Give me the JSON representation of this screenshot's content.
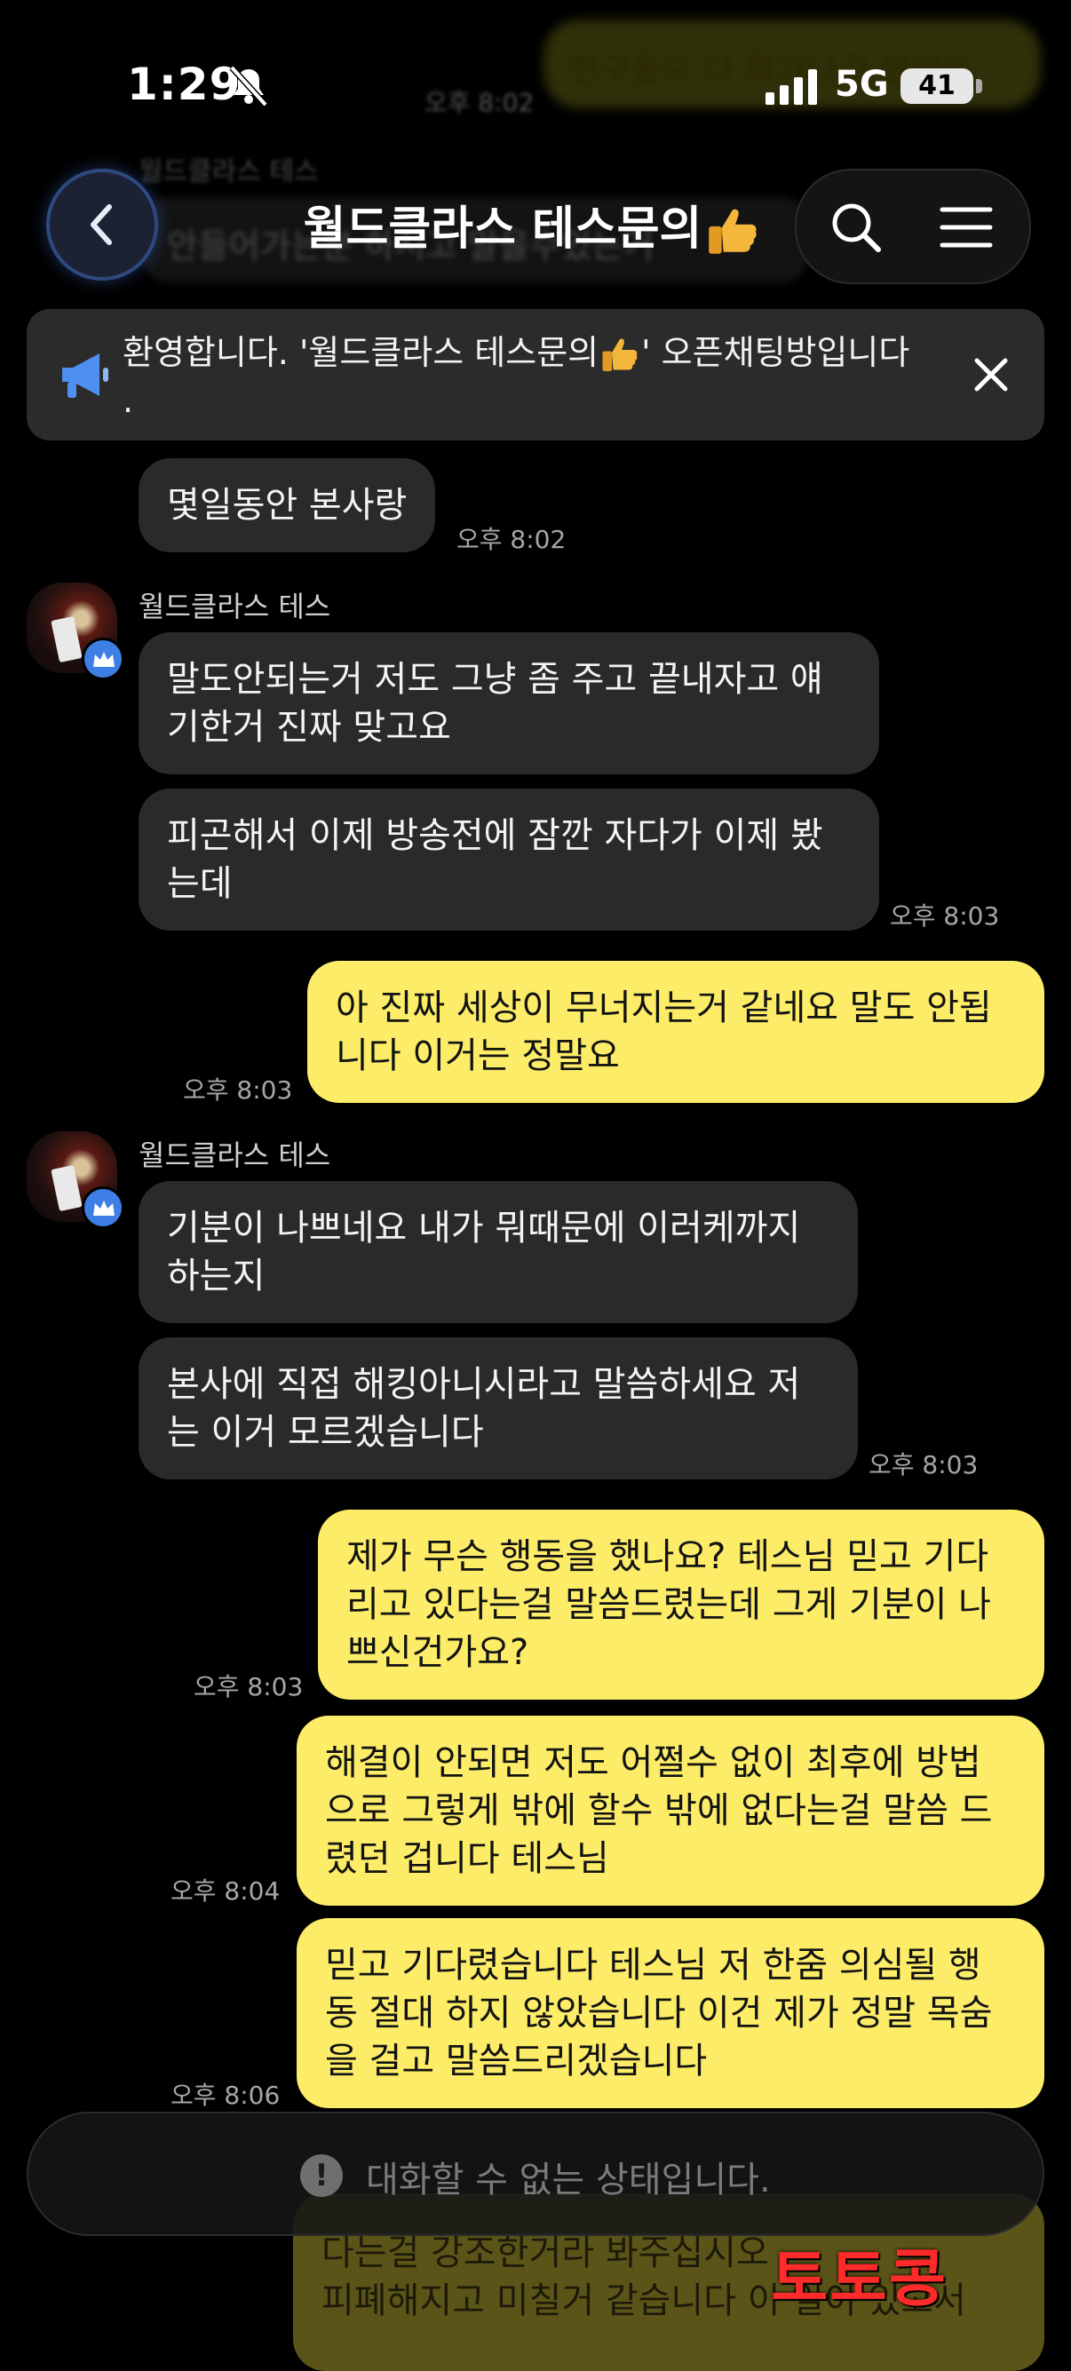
{
  "status_bar": {
    "time": "1:29",
    "network": "5G",
    "battery": "41"
  },
  "background_peek": {
    "top_right": "친구들도 다 화가나고 했겠죠",
    "left_sender": "월드클라스 테스",
    "left_text": "안들어가는분 하시고 말을수있는거",
    "time": "오후 8:02"
  },
  "header": {
    "title": "월드클라스 테스문의",
    "title_emoji": "thumbs-up-icon"
  },
  "notice": {
    "text": "환영합니다. '월드클라스 테스문의",
    "text_after": "' 오픈채팅방입니다",
    "text_tail": "."
  },
  "messages": [
    {
      "side": "in",
      "text": "몇일동안 본사랑",
      "time": "오후 8:02"
    },
    {
      "side": "in",
      "sender": "월드클라스 테스",
      "text": [
        "말도안되는거 저도 그냥 좀 주고 끝내자고 얘",
        "기한거 진짜 맞고요"
      ]
    },
    {
      "side": "in",
      "text": [
        "피곤해서 이제 방송전에 잠깐 자다가 이제 봤",
        "는데"
      ],
      "time": "오후 8:03"
    },
    {
      "side": "out",
      "text": [
        "아 진짜 세상이 무너지는거 같네요 말도 안됩",
        "니다 이거는 정말요"
      ],
      "time": "오후 8:03"
    },
    {
      "side": "in",
      "sender": "월드클라스 테스",
      "text": [
        "기분이 나쁘네요 내가 뭐때문에 이러케까지",
        "하는지"
      ]
    },
    {
      "side": "in",
      "text": [
        "본사에 직접 해킹아니시라고 말씀하세요 저",
        "는 이거 모르겠습니다"
      ],
      "time": "오후 8:03"
    },
    {
      "side": "out",
      "text": [
        "제가 무슨 행동을 했나요? 테스님 믿고 기다",
        "리고 있다는걸 말씀드렸는데 그게 기분이 나",
        "쁘신건가요?"
      ],
      "time": "오후 8:03"
    },
    {
      "side": "out",
      "text": [
        "해결이 안되면 저도 어쩔수 없이 최후에 방법",
        "으로 그렇게 밖에 할수 밖에 없다는걸 말씀 드",
        "렸던 겁니다 테스님"
      ],
      "time": "오후 8:04"
    },
    {
      "side": "out",
      "text": [
        "믿고 기다렸습니다 테스님 저 한줌 의심될 행",
        "동 절대 하지 않았습니다 이건 제가 정말 목숨",
        "을 걸고 말씀드리겠습니다"
      ],
      "time": "오후 8:06"
    }
  ],
  "input": {
    "placeholder": "대화할 수 없는 상태입니다."
  },
  "under_input": [
    "다는걸 강조한거라 봐주십시오",
    "피폐해지고 미칠거 같습니다 이 일이 있고서"
  ],
  "watermark": "토토콩"
}
